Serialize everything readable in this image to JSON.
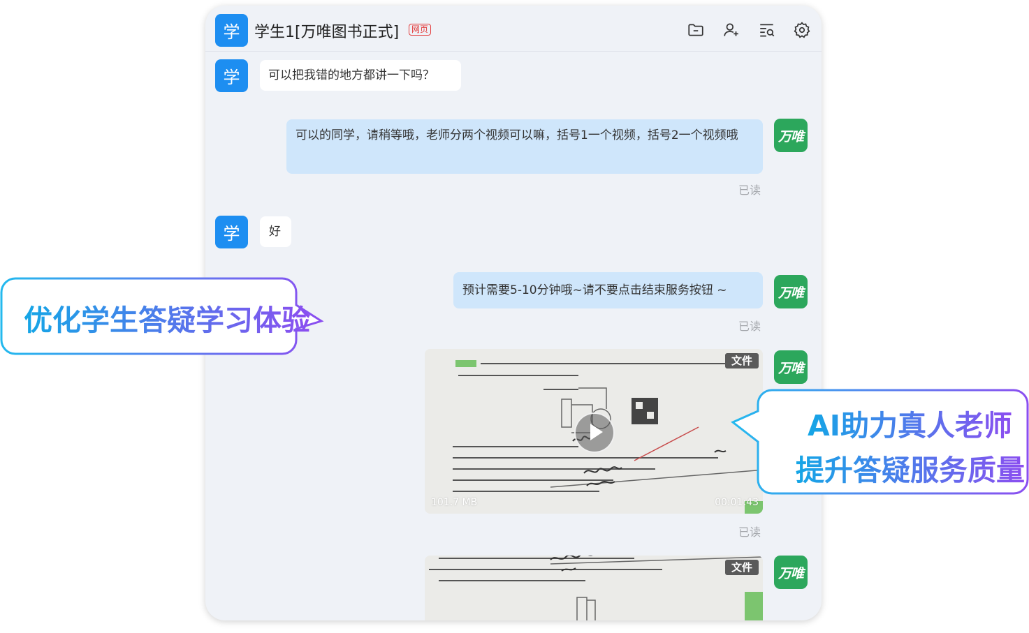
{
  "header": {
    "avatar_char": "学",
    "title": "学生1[万唯图书正式]",
    "tag": "网页",
    "icons": [
      "folder-icon",
      "add-user-icon",
      "search-list-icon",
      "gear-icon"
    ]
  },
  "avatars": {
    "student": "学",
    "teacher": "万唯"
  },
  "messages": {
    "m1": "可以把我错的地方都讲一下吗？",
    "m2": "可以的同学，请稍等哦，老师分两个视频可以嘛，括号1一个视频，括号2一个视频哦",
    "m3": "好",
    "m4": "预计需要5-10分钟哦~请不要点击结束服务按钮 ~",
    "read": "已读"
  },
  "video1": {
    "tag": "文件",
    "size": "101.7 MB",
    "duration": "00:01:43"
  },
  "video2": {
    "tag": "文件"
  },
  "callouts": {
    "left": "优化学生答疑学习体验",
    "right_line1": "AI助力真人老师",
    "right_line2": "提升答疑服务质量"
  },
  "colors": {
    "student_avatar": "#1d8ef1",
    "teacher_avatar": "#2ca75c",
    "teacher_bubble": "#cfe6fb"
  }
}
